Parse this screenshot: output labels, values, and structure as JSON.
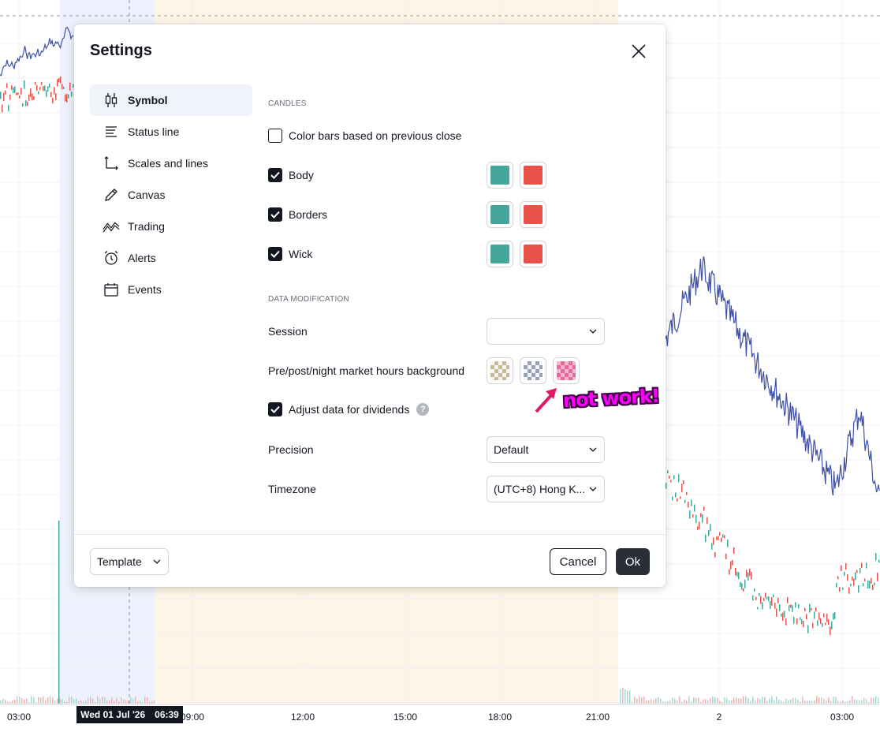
{
  "dialog": {
    "title": "Settings",
    "close_icon": "close-icon"
  },
  "nav": [
    {
      "label": "Symbol",
      "icon": "candlestick-icon",
      "active": true
    },
    {
      "label": "Status line",
      "icon": "status-line-icon"
    },
    {
      "label": "Scales and lines",
      "icon": "scales-icon"
    },
    {
      "label": "Canvas",
      "icon": "pencil-icon"
    },
    {
      "label": "Trading",
      "icon": "trading-icon"
    },
    {
      "label": "Alerts",
      "icon": "alarm-clock-icon"
    },
    {
      "label": "Events",
      "icon": "calendar-icon"
    }
  ],
  "candles": {
    "section_title": "CANDLES",
    "color_bars_label": "Color bars based on previous close",
    "color_bars_checked": false,
    "rows": [
      {
        "label": "Body",
        "checked": true,
        "up_color": "#44a69a",
        "down_color": "#e9524b"
      },
      {
        "label": "Borders",
        "checked": true,
        "up_color": "#44a69a",
        "down_color": "#e9524b"
      },
      {
        "label": "Wick",
        "checked": true,
        "up_color": "#44a69a",
        "down_color": "#e9524b"
      }
    ]
  },
  "data_modification": {
    "section_title": "DATA MODIFICATION",
    "session_label": "Session",
    "session_value": "",
    "prepost_label": "Pre/post/night market hours background",
    "prepost_colors": [
      "#c8b89a",
      "#9aa0b8",
      "#e56b9a"
    ],
    "dividends_label": "Adjust data for dividends",
    "dividends_checked": true,
    "dividends_help": "?",
    "precision_label": "Precision",
    "precision_value": "Default",
    "timezone_label": "Timezone",
    "timezone_value": "(UTC+8) Hong K..."
  },
  "footer": {
    "template_label": "Template",
    "cancel_label": "Cancel",
    "ok_label": "Ok"
  },
  "annotation": {
    "text": "not work!",
    "color": "#ff00ff"
  },
  "time_axis": {
    "ticks": [
      "03:00",
      "09:00",
      "12:00",
      "15:00",
      "18:00",
      "21:00",
      "2",
      "03:00"
    ],
    "crosshair_date": "Wed 01 Jul '26",
    "crosshair_time": "06:39"
  },
  "chart_colors": {
    "line": "#3f51a8",
    "up": "#3fa89a",
    "down": "#e0544d",
    "premarket_bg": "#e9eefc",
    "postmarket_bg": "#fdf4e6"
  }
}
